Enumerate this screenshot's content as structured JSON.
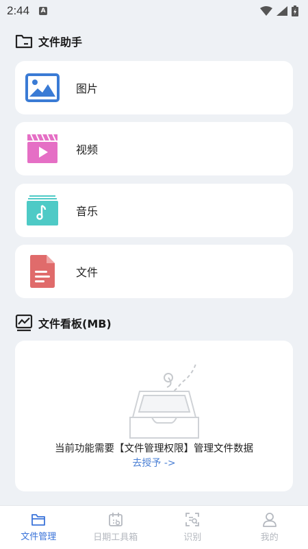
{
  "status_bar": {
    "time": "2:44",
    "badge": "A"
  },
  "files_section": {
    "title": "文件助手",
    "items": [
      {
        "label": "图片",
        "icon": "image-icon"
      },
      {
        "label": "视频",
        "icon": "video-icon"
      },
      {
        "label": "音乐",
        "icon": "music-icon"
      },
      {
        "label": "文件",
        "icon": "document-icon"
      }
    ]
  },
  "board_section": {
    "title": "文件看板(MB)",
    "empty_message": "当前功能需要【文件管理权限】管理文件数据",
    "grant_link": "去授予 ->"
  },
  "tabbar": {
    "tabs": [
      {
        "label": "文件管理",
        "icon": "folder-icon",
        "active": true
      },
      {
        "label": "日期工具箱",
        "icon": "calendar-icon",
        "active": false
      },
      {
        "label": "识别",
        "icon": "scan-icon",
        "active": false
      },
      {
        "label": "我的",
        "icon": "person-icon",
        "active": false
      }
    ]
  },
  "colors": {
    "background": "#eef1f5",
    "accent": "#3a73d9",
    "image_icon": "#3a7bd5",
    "video_icon": "#e56fc5",
    "music_icon": "#4ecac6",
    "document_icon": "#e06b6b"
  }
}
